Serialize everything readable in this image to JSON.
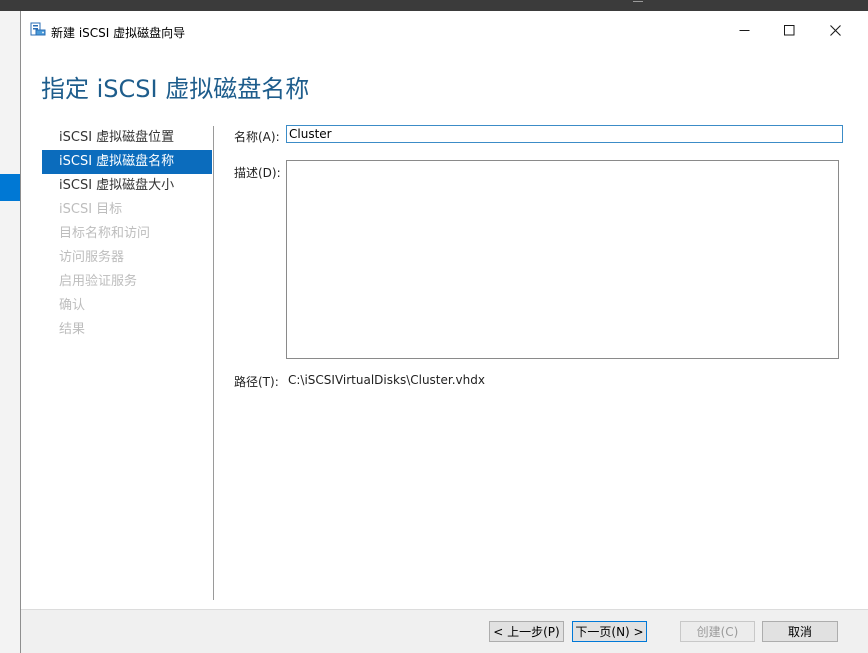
{
  "window": {
    "title": "新建 iSCSI 虚拟磁盘向导"
  },
  "page": {
    "heading": "指定 iSCSI 虚拟磁盘名称"
  },
  "steps": [
    {
      "label": "iSCSI 虚拟磁盘位置",
      "state": "enabled"
    },
    {
      "label": "iSCSI 虚拟磁盘名称",
      "state": "active"
    },
    {
      "label": "iSCSI 虚拟磁盘大小",
      "state": "enabled"
    },
    {
      "label": "iSCSI 目标",
      "state": "disabled"
    },
    {
      "label": "目标名称和访问",
      "state": "disabled"
    },
    {
      "label": "访问服务器",
      "state": "disabled"
    },
    {
      "label": "启用验证服务",
      "state": "disabled"
    },
    {
      "label": "确认",
      "state": "disabled"
    },
    {
      "label": "结果",
      "state": "disabled"
    }
  ],
  "form": {
    "name_label": "名称(A):",
    "name_value": "Cluster",
    "description_label": "描述(D):",
    "description_value": "",
    "path_label": "路径(T):",
    "path_value": "C:\\iSCSIVirtualDisks\\Cluster.vhdx"
  },
  "buttons": {
    "previous": "< 上一步(P)",
    "next": "下一页(N) >",
    "create": "创建(C)",
    "cancel": "取消"
  },
  "colors": {
    "heading": "#1e5d8c",
    "selection": "#0b6cbd",
    "disabled_text": "#bdbdbd"
  },
  "icons": [
    "wizard-app-icon",
    "minimize-icon",
    "maximize-icon",
    "close-icon"
  ]
}
